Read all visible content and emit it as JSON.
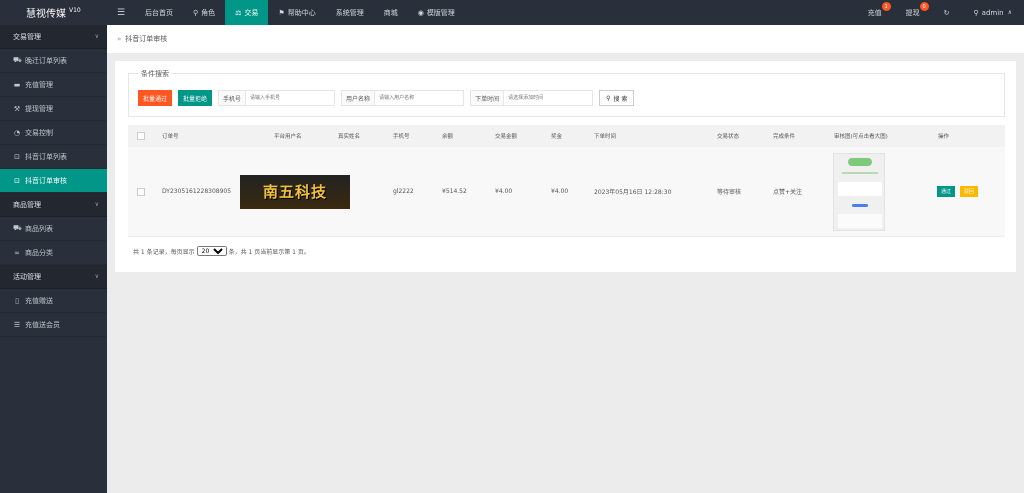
{
  "brand": {
    "name": "慧视传媒",
    "version": "V10"
  },
  "topnav": {
    "toggle_glyph": "☰",
    "items": [
      {
        "label": "后台首页",
        "icon": ""
      },
      {
        "label": "角色",
        "icon": "user-icon"
      },
      {
        "label": "交易",
        "icon": "scale-icon",
        "active": true
      },
      {
        "label": "帮助中心",
        "icon": "flag-icon"
      },
      {
        "label": "系统管理",
        "icon": ""
      },
      {
        "label": "商城",
        "icon": ""
      },
      {
        "label": "模版管理",
        "icon": "database-icon"
      }
    ],
    "right": {
      "recharge_label": "充值",
      "recharge_badge": "1",
      "withdraw_label": "提现",
      "withdraw_badge": "0",
      "refresh_glyph": "↻",
      "user_label": "admin"
    }
  },
  "sidebar": [
    {
      "type": "group",
      "label": "交易管理"
    },
    {
      "type": "item",
      "label": "晚迁订单列表",
      "icon": "cart-icon"
    },
    {
      "type": "item",
      "label": "充值管理",
      "icon": "chat-icon"
    },
    {
      "type": "item",
      "label": "提现管理",
      "icon": "hammer-icon"
    },
    {
      "type": "item",
      "label": "交易控制",
      "icon": "gauge-icon"
    },
    {
      "type": "item",
      "label": "抖音订单列表",
      "icon": "lock-icon"
    },
    {
      "type": "item",
      "label": "抖音订单审核",
      "icon": "lock-icon",
      "active": true
    },
    {
      "type": "group",
      "label": "商品管理"
    },
    {
      "type": "item",
      "label": "商品列表",
      "icon": "cart-icon"
    },
    {
      "type": "item",
      "label": "商品分类",
      "icon": "link-icon"
    },
    {
      "type": "group",
      "label": "活动管理"
    },
    {
      "type": "item",
      "label": "充值赠送",
      "icon": "phone-icon"
    },
    {
      "type": "item",
      "label": "充值送会员",
      "icon": "list-icon"
    }
  ],
  "breadcrumb": {
    "sep": "»",
    "label": "抖音订单审核"
  },
  "search": {
    "legend": "条件搜索",
    "batch_pass_label": "批量通过",
    "batch_reject_label": "批量拒绝",
    "phone_label": "手机号",
    "phone_placeholder": "请输入手机号",
    "username_label": "用户名称",
    "username_placeholder": "请输入用户名称",
    "time_label": "下单时间",
    "time_placeholder": "请选择添加时间",
    "search_button": "搜 索"
  },
  "table": {
    "headers": [
      "订单号",
      "平台用户名",
      "真实姓名",
      "手机号",
      "余额",
      "交易金额",
      "奖金",
      "下单时间",
      "交易状态",
      "完成条件",
      "审核图(可点击看大图)",
      "操作"
    ],
    "rows": [
      {
        "order_no": "DY2305161228308905",
        "platform_user": "南五科技",
        "real_name": "",
        "phone": "gl2222",
        "balance": "¥514.52",
        "amount": "¥4.00",
        "bonus": "¥4.00",
        "time": "2023年05月16日 12:28:30",
        "status": "等待审核",
        "condition": "点赞+关注",
        "pass_label": "通过",
        "reject_label": "驳回"
      }
    ]
  },
  "pager": {
    "prefix": "共 1 条记录，每页显示",
    "page_size": "20",
    "suffix": "条，共 1 页当前显示第 1 页。"
  }
}
